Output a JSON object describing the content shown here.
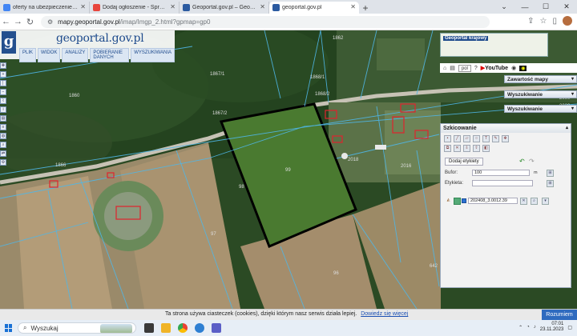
{
  "browser": {
    "tabs": [
      {
        "label": "oferty na ubezpieczenie auta - ...",
        "color": "#4285f4",
        "active": false
      },
      {
        "label": "Dodaj ogłoszenie - Sprzedajem...",
        "color": "#e8453c",
        "active": false
      },
      {
        "label": "Geoportal.gov.pl – Geoportal In...",
        "color": "#2b5aa0",
        "active": false
      },
      {
        "label": "geoportal.gov.pl",
        "color": "#2b5aa0",
        "active": true
      }
    ],
    "new_tab": "+",
    "window_controls": [
      "⌄",
      "—",
      "☐",
      "✕"
    ],
    "url_host": "mapy.geoportal.gov.pl",
    "url_path": "/imap/Imgp_2.html?gpmap=gp0"
  },
  "geoportal": {
    "logo_letter": "g",
    "logo_text": "geoportal.gov.pl",
    "menu": [
      "PLIK",
      "WIDOK",
      "ANALIZY",
      "POBIERANIE DANYCH",
      "WYSZUKIWANIA"
    ],
    "minimap_title": "Geoportal krajowy",
    "language": "pol",
    "youtube": "YouTube",
    "panels": [
      "Zawartość mapy",
      "Wyszukiwanie",
      "Wyszukiwanie"
    ]
  },
  "map_labels": [
    {
      "text": "1862",
      "key": "a"
    },
    {
      "text": "1867/1",
      "key": "b"
    },
    {
      "text": "1868/1",
      "key": "c"
    },
    {
      "text": "1868/2",
      "key": "d"
    },
    {
      "text": "1867/2",
      "key": "e"
    },
    {
      "text": "1866",
      "key": "f"
    },
    {
      "text": "1860",
      "key": "g"
    },
    {
      "text": "2018",
      "key": "h"
    },
    {
      "text": "2016",
      "key": "i"
    },
    {
      "text": "99",
      "key": "j"
    },
    {
      "text": "97",
      "key": "k"
    },
    {
      "text": "98",
      "key": "l"
    },
    {
      "text": "96",
      "key": "m"
    },
    {
      "text": "642",
      "key": "n"
    },
    {
      "text": "2029",
      "key": "o"
    },
    {
      "text": "2000",
      "key": "p"
    }
  ],
  "sketch": {
    "title": "Szkicowanie",
    "add_label": "Dodaj etykiety",
    "buffer_label": "Bufor:",
    "buffer_value": "100",
    "buffer_unit": "m",
    "label_label": "Etykieta:",
    "label_value": "",
    "layer_name": "202408_3.0012.39"
  },
  "cookie": {
    "text": "Ta strona używa ciasteczek (cookies), dzięki którym nasz serwis działa lepiej.",
    "link": "Dowiedz się więcej",
    "button": "Rozumiem"
  },
  "taskbar": {
    "search_placeholder": "Wyszukaj",
    "time": "07:01",
    "date": "23.11.2023"
  }
}
